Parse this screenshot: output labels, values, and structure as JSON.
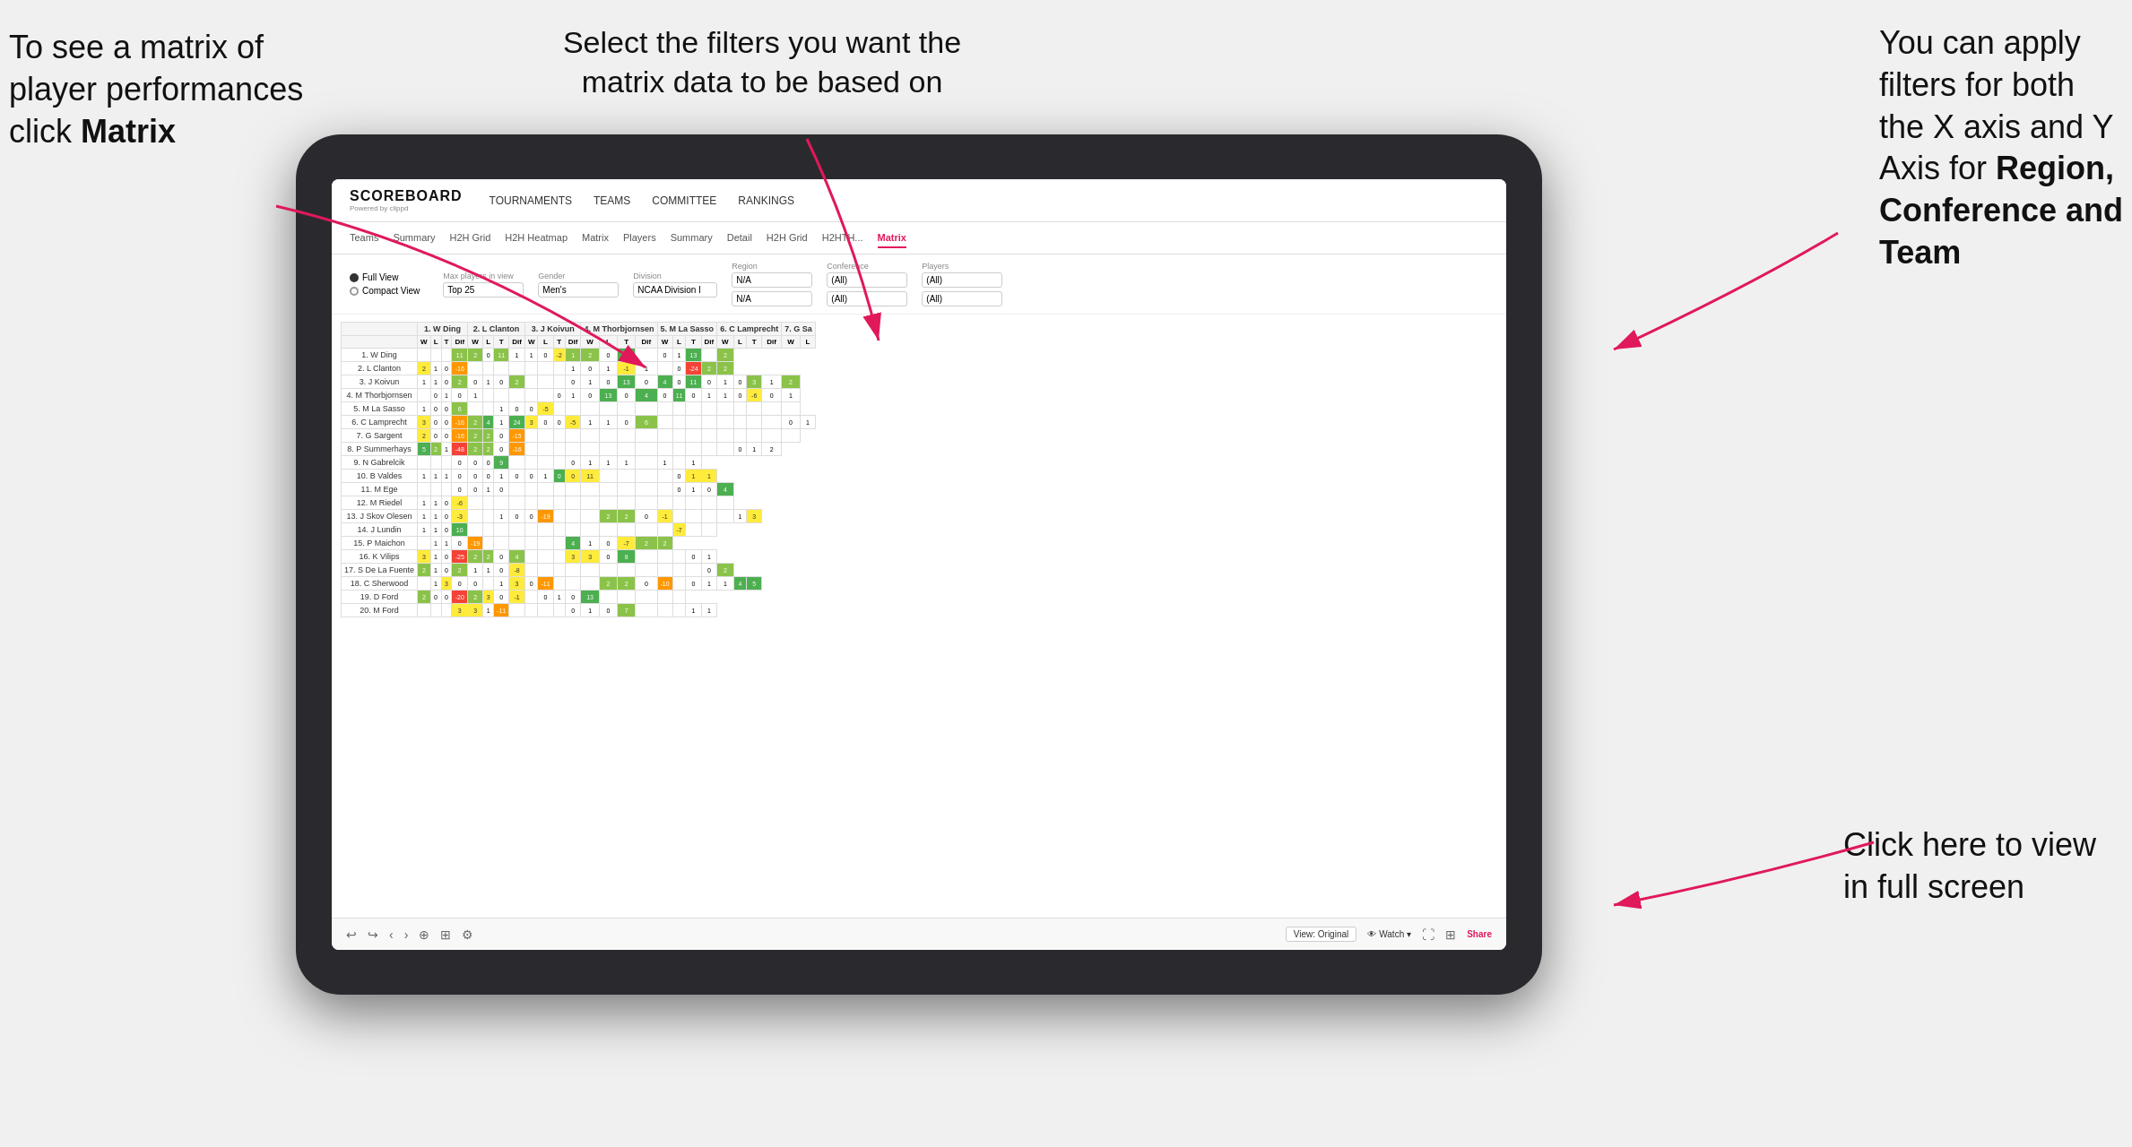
{
  "annotations": {
    "top_left": {
      "line1": "To see a matrix of",
      "line2": "player performances",
      "line3": "click ",
      "bold": "Matrix"
    },
    "top_center": {
      "text": "Select the filters you want the matrix data to be based on"
    },
    "top_right": {
      "line1": "You  can apply",
      "line2": "filters for both",
      "line3": "the X axis and Y",
      "line4": "Axis for ",
      "bold1": "Region,",
      "line5": "",
      "bold2": "Conference and",
      "line6": "",
      "bold3": "Team"
    },
    "bottom_right": {
      "line1": "Click here to view",
      "line2": "in full screen"
    }
  },
  "nav": {
    "logo": "SCOREBOARD",
    "logo_sub": "Powered by clippd",
    "items": [
      "TOURNAMENTS",
      "TEAMS",
      "COMMITTEE",
      "RANKINGS"
    ]
  },
  "tabs": {
    "items": [
      "Teams",
      "Summary",
      "H2H Grid",
      "H2H Heatmap",
      "Matrix",
      "Players",
      "Summary",
      "Detail",
      "H2H Grid",
      "H2HTH...",
      "Matrix"
    ],
    "active_index": 10
  },
  "filters": {
    "views": [
      "Full View",
      "Compact View"
    ],
    "selected_view": "Full View",
    "groups": [
      {
        "label": "Max players in view",
        "value": "Top 25"
      },
      {
        "label": "Gender",
        "value": "Men's"
      },
      {
        "label": "Division",
        "value": "NCAA Division I"
      },
      {
        "label": "Region",
        "values": [
          "N/A",
          "N/A"
        ]
      },
      {
        "label": "Conference",
        "values": [
          "(All)",
          "(All)"
        ]
      },
      {
        "label": "Players",
        "values": [
          "(All)",
          "(All)"
        ]
      }
    ]
  },
  "matrix": {
    "col_headers": [
      "1. W Ding",
      "2. L Clanton",
      "3. J Koivun",
      "4. M Thorbjornsen",
      "5. M La Sasso",
      "6. C Lamprecht",
      "7. G Sa"
    ],
    "sub_headers": [
      "W",
      "L",
      "T",
      "Dif"
    ],
    "rows": [
      {
        "name": "1. W Ding",
        "cells": [
          "",
          "",
          "",
          "11",
          "2",
          "0",
          "11",
          "1",
          "1",
          "0",
          "-2",
          "1",
          "2",
          "0",
          "17",
          "",
          "0",
          "1",
          "13",
          "",
          "2"
        ]
      },
      {
        "name": "2. L Clanton",
        "cells": [
          "2",
          "1",
          "0",
          "-16",
          "",
          "",
          "",
          "",
          "",
          "",
          "",
          "1",
          "0",
          "1",
          "-1",
          "1",
          "",
          "0",
          "-24",
          "2",
          "2"
        ]
      },
      {
        "name": "3. J Koivun",
        "cells": [
          "1",
          "1",
          "0",
          "2",
          "0",
          "1",
          "0",
          "2",
          "",
          "",
          "",
          "0",
          "1",
          "0",
          "13",
          "0",
          "4",
          "0",
          "11",
          "0",
          "1",
          "0",
          "3",
          "1",
          "2"
        ]
      },
      {
        "name": "4. M Thorbjornsen",
        "cells": [
          "",
          "0",
          "1",
          "0",
          "1",
          "",
          "",
          "",
          "",
          "",
          "0",
          "1",
          "0",
          "13",
          "0",
          "4",
          "0",
          "11",
          "0",
          "1",
          "1",
          "0",
          "-6",
          "0",
          "1"
        ]
      },
      {
        "name": "5. M La Sasso",
        "cells": [
          "1",
          "0",
          "0",
          "6",
          "",
          "",
          "1",
          "0",
          "0",
          "-5",
          "",
          "",
          "",
          "",
          "",
          "",
          "",
          "",
          "",
          "",
          "",
          "",
          "",
          "",
          ""
        ]
      },
      {
        "name": "6. C Lamprecht",
        "cells": [
          "3",
          "0",
          "0",
          "-16",
          "2",
          "4",
          "1",
          "24",
          "3",
          "0",
          "0",
          "-5",
          "1",
          "1",
          "0",
          "6",
          "",
          "",
          "",
          "",
          "",
          "",
          "",
          "",
          "0",
          "1"
        ]
      },
      {
        "name": "7. G Sargent",
        "cells": [
          "2",
          "0",
          "0",
          "-16",
          "2",
          "2",
          "0",
          "-15",
          "",
          "",
          "",
          "",
          "",
          "",
          "",
          "",
          "",
          "",
          "",
          "",
          "",
          "",
          "",
          "",
          ""
        ]
      },
      {
        "name": "8. P Summerhays",
        "cells": [
          "5",
          "2",
          "1",
          "-48",
          "2",
          "2",
          "0",
          "-16",
          "",
          "",
          "",
          "",
          "",
          "",
          "",
          "",
          "",
          "",
          "",
          "",
          "",
          "0",
          "1",
          "2"
        ]
      },
      {
        "name": "9. N Gabrelcik",
        "cells": [
          "",
          "",
          "",
          "0",
          "0",
          "0",
          "9",
          "",
          "",
          "",
          "",
          "0",
          "1",
          "1",
          "1",
          "",
          "1",
          "",
          "1"
        ]
      },
      {
        "name": "10. B Valdes",
        "cells": [
          "1",
          "1",
          "1",
          "0",
          "0",
          "0",
          "1",
          "0",
          "0",
          "1",
          "0",
          "0",
          "11",
          "",
          "",
          "",
          "",
          "0",
          "1",
          "1"
        ]
      },
      {
        "name": "11. M Ege",
        "cells": [
          "",
          "",
          "",
          "0",
          "0",
          "1",
          "0",
          "",
          "",
          "",
          "",
          "",
          "",
          "",
          "",
          "",
          "",
          "0",
          "1",
          "0",
          "4"
        ]
      },
      {
        "name": "12. M Riedel",
        "cells": [
          "1",
          "1",
          "0",
          "-6",
          "",
          "",
          "",
          "",
          "",
          "",
          "",
          "",
          "",
          "",
          "",
          "",
          "",
          "",
          "",
          "",
          ""
        ]
      },
      {
        "name": "13. J Skov Olesen",
        "cells": [
          "1",
          "1",
          "0",
          "-3",
          "",
          "",
          "1",
          "0",
          "0",
          "-19",
          "",
          "",
          "",
          "2",
          "2",
          "0",
          "-1",
          "",
          "",
          "",
          "",
          "1",
          "3"
        ]
      },
      {
        "name": "14. J Lundin",
        "cells": [
          "1",
          "1",
          "0",
          "10",
          "",
          "",
          "",
          "",
          "",
          "",
          "",
          "",
          "",
          "",
          "",
          "",
          "",
          "-7",
          "",
          ""
        ]
      },
      {
        "name": "15. P Maichon",
        "cells": [
          "",
          "1",
          "1",
          "0",
          "-19",
          "",
          "",
          "",
          "",
          "",
          "",
          "4",
          "1",
          "0",
          "-7",
          "2",
          "2"
        ]
      },
      {
        "name": "16. K Vilips",
        "cells": [
          "3",
          "1",
          "0",
          "-25",
          "2",
          "2",
          "0",
          "4",
          "",
          "",
          "",
          "3",
          "3",
          "0",
          "8",
          "",
          "",
          "",
          "0",
          "1"
        ]
      },
      {
        "name": "17. S De La Fuente",
        "cells": [
          "2",
          "1",
          "0",
          "2",
          "1",
          "1",
          "0",
          "-8",
          "",
          "",
          "",
          "",
          "",
          "",
          "",
          "",
          "",
          "",
          "",
          "0",
          "2"
        ]
      },
      {
        "name": "18. C Sherwood",
        "cells": [
          "",
          "1",
          "3",
          "0",
          "0",
          "",
          "1",
          "3",
          "0",
          "-11",
          "",
          "",
          "",
          "2",
          "2",
          "0",
          "-10",
          "",
          "0",
          "1",
          "1",
          "4",
          "5"
        ]
      },
      {
        "name": "19. D Ford",
        "cells": [
          "2",
          "0",
          "0",
          "-20",
          "2",
          "3",
          "0",
          "-1",
          "",
          "0",
          "1",
          "0",
          "13",
          "",
          "",
          "",
          "",
          ""
        ]
      },
      {
        "name": "20. M Ford",
        "cells": [
          "",
          "",
          "",
          "3",
          "3",
          "1",
          "-11",
          "",
          "",
          "",
          "",
          "0",
          "1",
          "0",
          "7",
          "",
          "",
          "",
          "1",
          "1"
        ]
      }
    ]
  },
  "bottom_bar": {
    "view_label": "View: Original",
    "watch_label": "Watch",
    "share_label": "Share"
  }
}
